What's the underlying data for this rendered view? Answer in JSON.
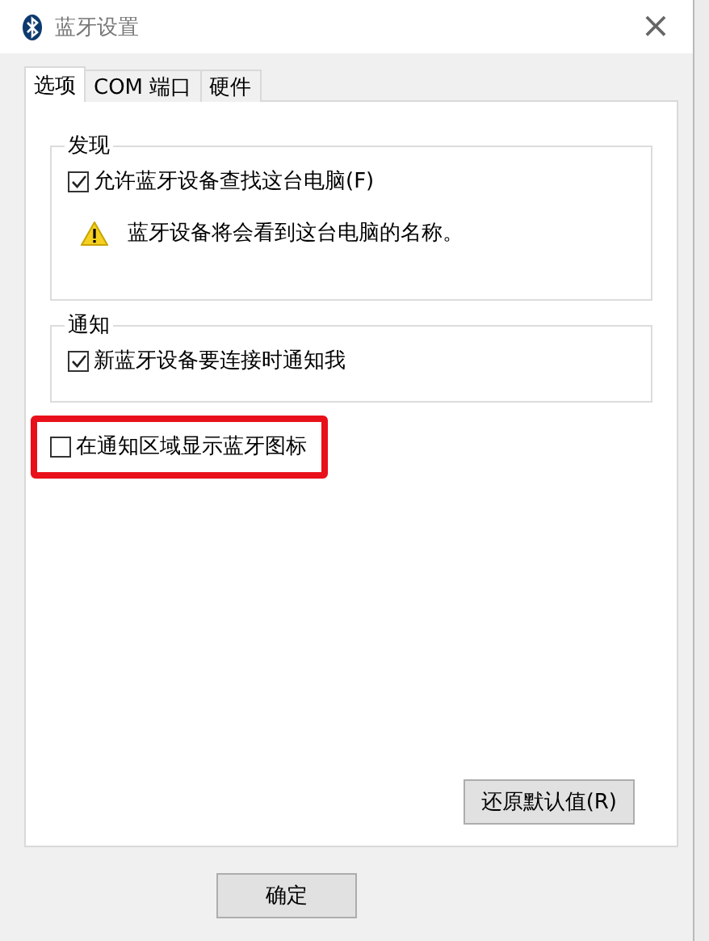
{
  "window": {
    "title": "蓝牙设置",
    "close": "×"
  },
  "tabs": [
    {
      "label": "选项",
      "selected": true
    },
    {
      "label": "COM 端口",
      "selected": false
    },
    {
      "label": "硬件",
      "selected": false
    }
  ],
  "groups": [
    {
      "title": "发现",
      "items": [
        {
          "kind": "checkbox",
          "label": "允许蓝牙设备查找这台电脑(F)",
          "checked": true
        },
        {
          "kind": "warning",
          "label": "蓝牙设备将会看到这台电脑的名称。"
        }
      ]
    },
    {
      "title": "通知",
      "items": [
        {
          "kind": "checkbox",
          "label": "新蓝牙设备要连接时通知我",
          "checked": true
        }
      ]
    }
  ],
  "standalone": [
    {
      "label": "在通知区域显示蓝牙图标",
      "checked": false,
      "highlighted": true
    }
  ],
  "restore_button": "还原默认值(R)",
  "buttons": [
    "确定"
  ]
}
